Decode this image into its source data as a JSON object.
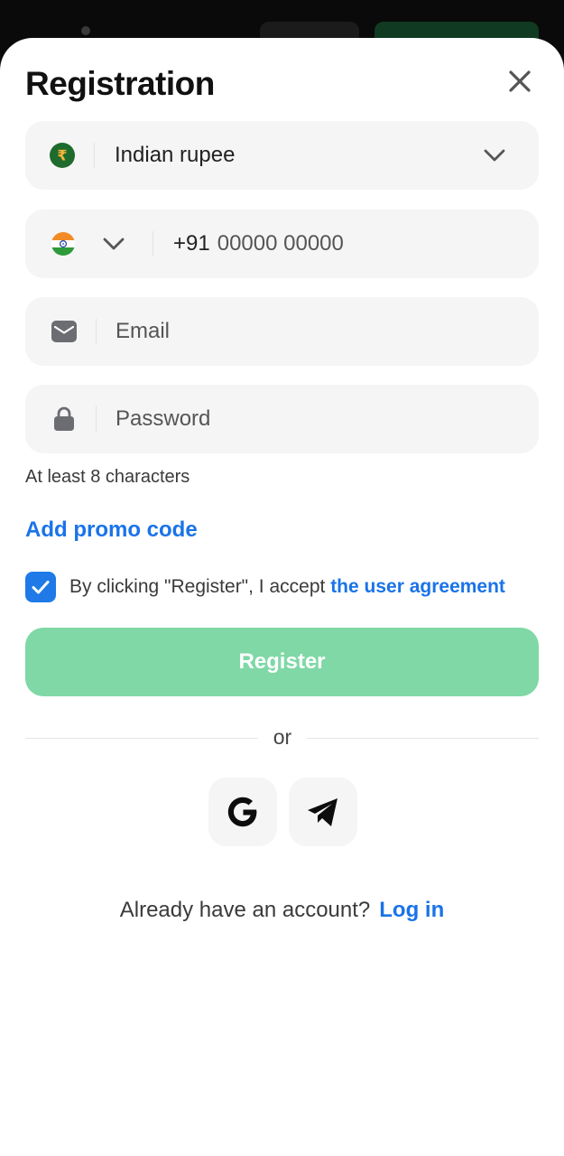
{
  "colors": {
    "accent_blue": "#1a73e8",
    "register_green": "#7fd8a6",
    "field_bg": "#f5f5f5"
  },
  "header": {
    "title": "Registration",
    "close_icon": "close-icon"
  },
  "currency": {
    "icon": "rupee-icon",
    "value": "Indian rupee",
    "dropdown_icon": "chevron-down-icon"
  },
  "phone": {
    "country_flag": "india-flag-icon",
    "dropdown_icon": "chevron-down-icon",
    "prefix": "+91",
    "placeholder": "00000 00000"
  },
  "email": {
    "icon": "mail-icon",
    "placeholder": "Email"
  },
  "password": {
    "icon": "lock-icon",
    "placeholder": "Password",
    "hint": "At least 8 characters"
  },
  "promo": {
    "label": "Add promo code"
  },
  "agreement": {
    "checked": true,
    "text": "By clicking \"Register\", I accept ",
    "link": "the user agreement"
  },
  "register": {
    "label": "Register"
  },
  "divider": {
    "label": "or"
  },
  "social": {
    "google_icon": "google-icon",
    "telegram_icon": "telegram-icon"
  },
  "footer": {
    "question": "Already have an account?",
    "login_label": "Log in"
  }
}
